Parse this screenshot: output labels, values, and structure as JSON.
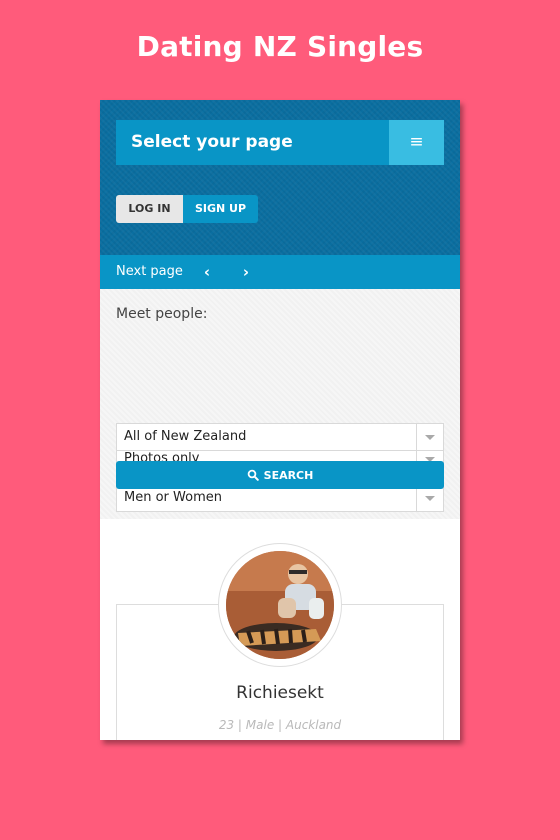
{
  "app": {
    "title": "Dating NZ Singles"
  },
  "header": {
    "page_select_label": "Select your page",
    "menu_icon": "hamburger-menu-icon",
    "login_label": "LOG IN",
    "signup_label": "SIGN UP"
  },
  "pager": {
    "label": "Next page",
    "prev_icon": "chevron-left-icon",
    "next_icon": "chevron-right-icon"
  },
  "filters": {
    "meet_label": "Meet people:",
    "photos": "Photos only",
    "gender": "Men or Women",
    "region": "All of New Zealand",
    "search_label": "SEARCH",
    "search_icon": "search-icon"
  },
  "profile": {
    "name": "Richiesekt",
    "meta": "23 | Male | Auckland"
  },
  "colors": {
    "background": "#ff5b7b",
    "header_dark": "#0a6ea0",
    "accent_blue": "#0995c6",
    "menu_button": "#39bde2"
  }
}
